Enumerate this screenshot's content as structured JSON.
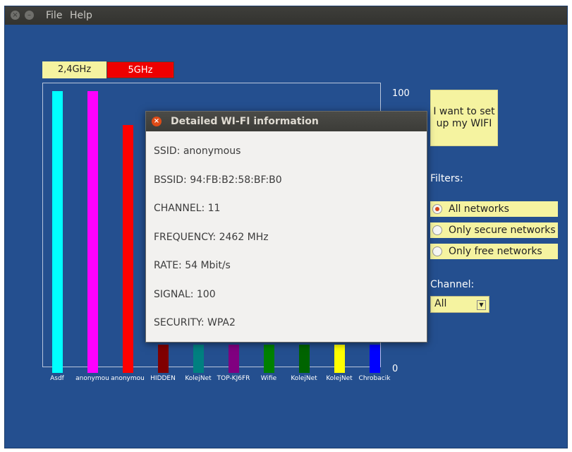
{
  "menu": {
    "file": "File",
    "help": "Help"
  },
  "bands": {
    "b24": "2,4GHz",
    "b5": "5GHz"
  },
  "chart_data": {
    "type": "bar",
    "categories": [
      "Asdf",
      "anonymou",
      "anonymou",
      "HIDDEN",
      "KolejNet",
      "TOP-KJ6FR",
      "Wifie",
      "KolejNet",
      "KolejNet",
      "Chrobacik"
    ],
    "values": [
      100,
      100,
      88,
      10,
      10,
      10,
      10,
      10,
      10,
      10
    ],
    "colors": [
      "#00ffff",
      "#ff00ff",
      "#ff0000",
      "#800000",
      "#008080",
      "#800080",
      "#008000",
      "#006400",
      "#ffff00",
      "#0000ff"
    ],
    "ylim": [
      0,
      100
    ],
    "yticks": [
      "100",
      "0"
    ]
  },
  "setup_button": {
    "line1": "I want to set",
    "line2": "up my WIFI"
  },
  "filters": {
    "label": "Filters:",
    "options": [
      {
        "label": "All networks",
        "selected": true
      },
      {
        "label": "Only secure networks",
        "selected": false
      },
      {
        "label": "Only free networks",
        "selected": false
      }
    ]
  },
  "channel": {
    "label": "Channel:",
    "value": "All"
  },
  "dialog": {
    "title": "Detailed WI-FI information",
    "ssid": "SSID: anonymous",
    "bssid": "BSSID: 94:FB:B2:58:BF:B0",
    "channel": "CHANNEL: 11",
    "frequency": "FREQUENCY: 2462 MHz",
    "rate": "RATE: 54 Mbit/s",
    "signal": "SIGNAL: 100",
    "security": "SECURITY: WPA2"
  }
}
